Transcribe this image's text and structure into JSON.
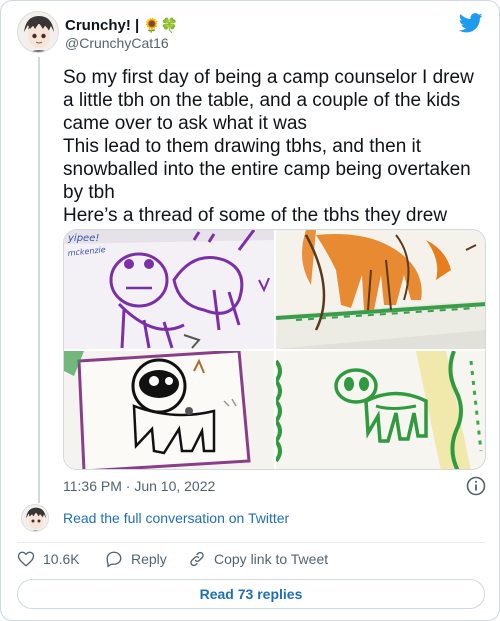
{
  "author": {
    "display_name": "Crunchy! |",
    "name_emojis": "🌻🍀",
    "handle": "@CrunchyCat16"
  },
  "tweet": {
    "lines": [
      "So my first day of being a camp counselor I drew a little tbh on the table, and a couple of the kids came over to ask what it was",
      "This lead to them drawing tbhs, and then it snowballed into the entire camp being overtaken by tbh",
      "Here’s a thread of some of the tbhs they drew"
    ],
    "timestamp": "11:36 PM · Jun 10, 2022"
  },
  "media": {
    "photo1_writing": [
      "yipee!",
      "mckenzie"
    ]
  },
  "conversation": {
    "link_text": "Read the full conversation on Twitter"
  },
  "actions": {
    "likes": "10.6K",
    "reply_label": "Reply",
    "copy_label": "Copy link to Tweet"
  },
  "replies_button": "Read 73 replies",
  "colors": {
    "twitter_blue": "#1d9bf0",
    "link_blue": "#1d6fb8",
    "muted_text": "#536471",
    "border": "#cfd9de"
  }
}
